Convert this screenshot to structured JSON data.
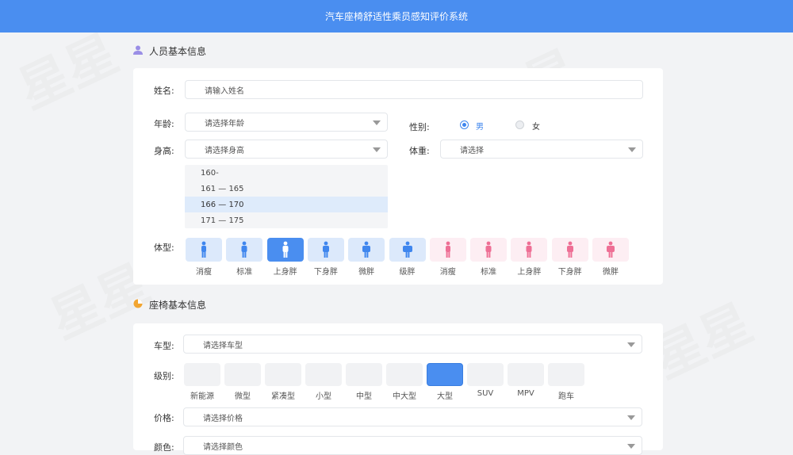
{
  "app_title": "汽车座椅舒适性乘员感知评价系统",
  "person_section": {
    "title": "人员基本信息",
    "name_label": "姓名:",
    "name_placeholder": "请输入姓名",
    "age_label": "年龄:",
    "age_placeholder": "请选择年龄",
    "gender_label": "性别:",
    "gender_options": [
      "男",
      "女"
    ],
    "gender_selected": "男",
    "height_label": "身高:",
    "height_placeholder": "请选择身高",
    "height_options": [
      "160-",
      "161 — 165",
      "166 — 170",
      "171 — 175"
    ],
    "height_highlighted": "166 — 170",
    "weight_label": "体重:",
    "weight_placeholder": "请选择",
    "body_type_label": "体型:",
    "body_types_male": [
      "消瘦",
      "标准",
      "上身胖",
      "下身胖",
      "微胖",
      "级胖"
    ],
    "body_types_female": [
      "消瘦",
      "标准",
      "上身胖",
      "下身胖",
      "微胖"
    ],
    "body_type_selected": "上身胖 (male)"
  },
  "seat_section": {
    "title": "座椅基本信息",
    "car_type_label": "车型:",
    "car_type_placeholder": "请选择车型",
    "class_label": "级别:",
    "classes": [
      "新能源",
      "微型",
      "紧凑型",
      "小型",
      "中型",
      "中大型",
      "大型",
      "SUV",
      "MPV",
      "跑车"
    ],
    "class_selected": "大型",
    "price_label": "价格:",
    "price_placeholder": "请选择价格",
    "color_label": "颜色:",
    "color_placeholder": "请选择颜色"
  },
  "colors": {
    "accent": "#4a8ef0",
    "male_tile": "#dce9fb",
    "female_tile": "#fdeef3",
    "female_figure": "#ee6f95"
  },
  "icons": {
    "person_section": "user-icon",
    "seat_section": "pie-chart-icon",
    "dropdown": "caret-down-icon",
    "body_male": "male-figure-icon",
    "body_female": "female-figure-icon"
  }
}
